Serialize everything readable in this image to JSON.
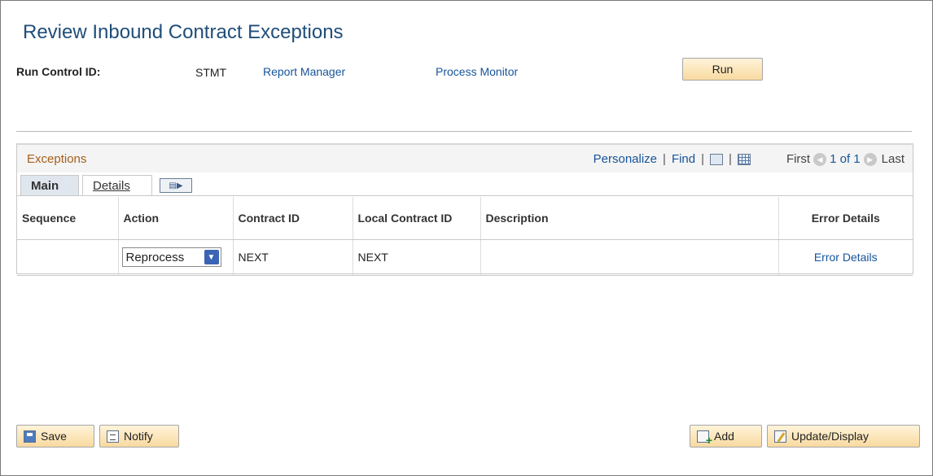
{
  "page": {
    "title": "Review Inbound Contract Exceptions"
  },
  "run_control": {
    "label": "Run Control ID:",
    "value": "STMT",
    "report_manager_link": "Report Manager",
    "process_monitor_link": "Process Monitor",
    "run_button": "Run"
  },
  "grid": {
    "caption": "Exceptions",
    "tools": {
      "personalize": "Personalize",
      "find": "Find",
      "separator": "|"
    },
    "navigation": {
      "first": "First",
      "count": "1 of 1",
      "last": "Last"
    },
    "tabs": [
      {
        "label": "Main",
        "active": true
      },
      {
        "label": "Details",
        "active": false
      }
    ],
    "show_all_tab_icon": "show-all-columns-icon",
    "columns": [
      "Sequence",
      "Action",
      "Contract ID",
      "Local Contract ID",
      "Description",
      "Error Details"
    ],
    "rows": [
      {
        "sequence": "",
        "action": "Reprocess",
        "contract_id": "NEXT",
        "local_contract_id": "NEXT",
        "description": "",
        "error_details": "Error Details"
      }
    ]
  },
  "footer": {
    "save": "Save",
    "notify": "Notify",
    "add": "Add",
    "update_display": "Update/Display"
  },
  "colors": {
    "title": "#1f4e79",
    "link": "#16549a",
    "grid_caption": "#a65d18",
    "button_bg": "#f8d9a0"
  }
}
